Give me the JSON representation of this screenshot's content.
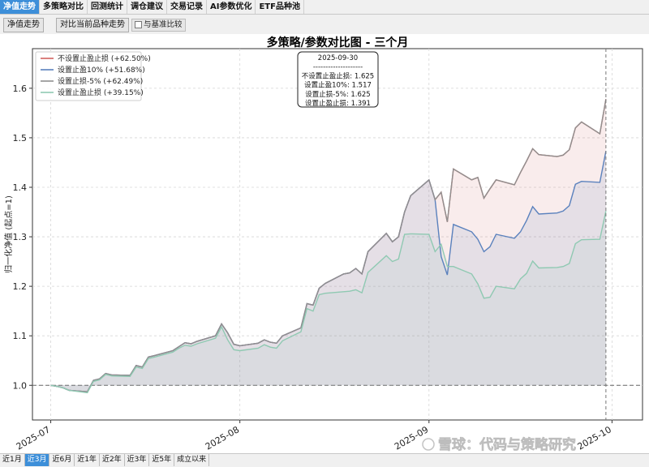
{
  "tabs": [
    {
      "label": "净值走势",
      "active": true
    },
    {
      "label": "多策略对比",
      "active": false
    },
    {
      "label": "回测统计",
      "active": false
    },
    {
      "label": "调仓建议",
      "active": false
    },
    {
      "label": "交易记录",
      "active": false
    },
    {
      "label": "AI参数优化",
      "active": false
    },
    {
      "label": "ETF品种池",
      "active": false
    }
  ],
  "toolbar": {
    "nav_button": "净值走势",
    "compare_button": "对比当前品种走势",
    "benchmark_checkbox": "与基准比较"
  },
  "watermark": "雪球：代码与策略研究",
  "periods": [
    {
      "label": "近1月",
      "active": false
    },
    {
      "label": "近3月",
      "active": true
    },
    {
      "label": "近6月",
      "active": false
    },
    {
      "label": "近1年",
      "active": false
    },
    {
      "label": "近2年",
      "active": false
    },
    {
      "label": "近3年",
      "active": false
    },
    {
      "label": "近5年",
      "active": false
    },
    {
      "label": "成立以来",
      "active": false
    }
  ],
  "chart_data": {
    "type": "line",
    "title": "多策略/参数对比图 - 三个月",
    "ylabel": "归一化净值 (起点=1)",
    "xlabel": "",
    "ylim": [
      0.93,
      1.68
    ],
    "yticks": [
      1.0,
      1.1,
      1.2,
      1.3,
      1.4,
      1.5,
      1.6
    ],
    "ytick_labels": [
      "1.0",
      "1.1",
      "1.2",
      "1.3",
      "1.4",
      "1.5",
      "1.6"
    ],
    "xlim": [
      "2025-06-28",
      "2025-10-06"
    ],
    "xticks": [
      "2025-07-01",
      "2025-08-01",
      "2025-09-01",
      "2025-10-01"
    ],
    "xtick_labels": [
      "2025-07",
      "2025-08",
      "2025-09",
      "2025-10"
    ],
    "baseline": 1.0,
    "grid": true,
    "legend_position": "top-left",
    "x": [
      "2025-07-01",
      "2025-07-02",
      "2025-07-03",
      "2025-07-04",
      "2025-07-07",
      "2025-07-08",
      "2025-07-09",
      "2025-07-10",
      "2025-07-11",
      "2025-07-14",
      "2025-07-15",
      "2025-07-16",
      "2025-07-17",
      "2025-07-18",
      "2025-07-21",
      "2025-07-22",
      "2025-07-23",
      "2025-07-24",
      "2025-07-25",
      "2025-07-28",
      "2025-07-29",
      "2025-07-30",
      "2025-07-31",
      "2025-08-01",
      "2025-08-04",
      "2025-08-05",
      "2025-08-06",
      "2025-08-07",
      "2025-08-08",
      "2025-08-11",
      "2025-08-12",
      "2025-08-13",
      "2025-08-14",
      "2025-08-15",
      "2025-08-18",
      "2025-08-19",
      "2025-08-20",
      "2025-08-21",
      "2025-08-22",
      "2025-08-25",
      "2025-08-26",
      "2025-08-27",
      "2025-08-28",
      "2025-08-29",
      "2025-09-01",
      "2025-09-02",
      "2025-09-03",
      "2025-09-04",
      "2025-09-05",
      "2025-09-08",
      "2025-09-09",
      "2025-09-10",
      "2025-09-11",
      "2025-09-12",
      "2025-09-15",
      "2025-09-16",
      "2025-09-17",
      "2025-09-18",
      "2025-09-19",
      "2025-09-22",
      "2025-09-23",
      "2025-09-24",
      "2025-09-25",
      "2025-09-26",
      "2025-09-29",
      "2025-09-30"
    ],
    "series": [
      {
        "name": "不设置止盈止损 (+62.50%)",
        "color": "#d0625f",
        "values": [
          1.0,
          0.998,
          0.995,
          0.99,
          0.987,
          1.01,
          1.013,
          1.024,
          1.021,
          1.02,
          1.04,
          1.037,
          1.057,
          1.06,
          1.07,
          1.078,
          1.086,
          1.084,
          1.089,
          1.1,
          1.124,
          1.106,
          1.083,
          1.08,
          1.085,
          1.092,
          1.087,
          1.085,
          1.1,
          1.116,
          1.165,
          1.162,
          1.196,
          1.206,
          1.225,
          1.227,
          1.236,
          1.225,
          1.27,
          1.307,
          1.29,
          1.3,
          1.35,
          1.383,
          1.415,
          1.375,
          1.39,
          1.33,
          1.437,
          1.415,
          1.42,
          1.378,
          1.397,
          1.415,
          1.405,
          1.43,
          1.453,
          1.478,
          1.466,
          1.462,
          1.465,
          1.476,
          1.52,
          1.532,
          1.508,
          1.578,
          1.625
        ]
      },
      {
        "name": "设置止盈10% (+51.68%)",
        "color": "#5a81bd",
        "values": [
          1.0,
          0.998,
          0.995,
          0.99,
          0.987,
          1.01,
          1.013,
          1.024,
          1.021,
          1.02,
          1.04,
          1.037,
          1.057,
          1.06,
          1.07,
          1.078,
          1.086,
          1.084,
          1.089,
          1.1,
          1.124,
          1.106,
          1.083,
          1.08,
          1.085,
          1.092,
          1.087,
          1.085,
          1.1,
          1.116,
          1.165,
          1.162,
          1.196,
          1.206,
          1.225,
          1.227,
          1.236,
          1.225,
          1.27,
          1.307,
          1.29,
          1.3,
          1.35,
          1.383,
          1.415,
          1.375,
          1.26,
          1.223,
          1.325,
          1.31,
          1.295,
          1.27,
          1.28,
          1.305,
          1.297,
          1.31,
          1.333,
          1.361,
          1.346,
          1.348,
          1.352,
          1.363,
          1.406,
          1.412,
          1.41,
          1.473,
          1.517
        ]
      },
      {
        "name": "设置止损-5% (+62.49%)",
        "color": "#8f8f8f",
        "values": [
          1.0,
          0.998,
          0.995,
          0.99,
          0.987,
          1.01,
          1.013,
          1.024,
          1.021,
          1.02,
          1.04,
          1.037,
          1.057,
          1.06,
          1.07,
          1.078,
          1.086,
          1.084,
          1.089,
          1.1,
          1.124,
          1.106,
          1.083,
          1.08,
          1.085,
          1.092,
          1.087,
          1.085,
          1.1,
          1.116,
          1.165,
          1.162,
          1.196,
          1.206,
          1.225,
          1.227,
          1.236,
          1.225,
          1.27,
          1.307,
          1.29,
          1.3,
          1.35,
          1.383,
          1.415,
          1.375,
          1.39,
          1.33,
          1.437,
          1.415,
          1.42,
          1.378,
          1.397,
          1.415,
          1.405,
          1.43,
          1.453,
          1.478,
          1.466,
          1.462,
          1.465,
          1.476,
          1.52,
          1.532,
          1.508,
          1.578,
          1.625
        ]
      },
      {
        "name": "设置止盈止损 (+39.15%)",
        "color": "#8fc9b2",
        "values": [
          1.0,
          0.998,
          0.995,
          0.99,
          0.985,
          1.008,
          1.011,
          1.022,
          1.019,
          1.018,
          1.037,
          1.034,
          1.054,
          1.057,
          1.067,
          1.075,
          1.081,
          1.079,
          1.084,
          1.095,
          1.118,
          1.092,
          1.072,
          1.07,
          1.075,
          1.082,
          1.077,
          1.075,
          1.09,
          1.108,
          1.155,
          1.15,
          1.183,
          1.186,
          1.189,
          1.19,
          1.193,
          1.187,
          1.228,
          1.262,
          1.25,
          1.255,
          1.305,
          1.306,
          1.305,
          1.27,
          1.285,
          1.24,
          1.24,
          1.225,
          1.205,
          1.176,
          1.178,
          1.2,
          1.195,
          1.215,
          1.226,
          1.251,
          1.237,
          1.238,
          1.24,
          1.246,
          1.286,
          1.294,
          1.295,
          1.352,
          1.391
        ]
      }
    ],
    "tooltip": {
      "date": "2025-09-30",
      "separator": "--------------------",
      "lines": [
        "不设置止盈止损: 1.625",
        "设置止盈10%: 1.517",
        "设置止损-5%: 1.625",
        "设置止盈止损: 1.391"
      ]
    },
    "cursor_date": "2025-09-30"
  }
}
